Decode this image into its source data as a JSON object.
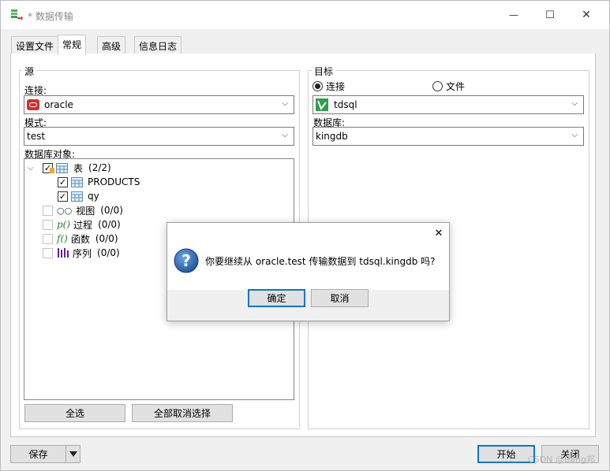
{
  "window": {
    "title": "* 数据传输",
    "icon": "data-transfer-icon",
    "controls": {
      "minimize": "—",
      "maximize": "☐",
      "close": "✕"
    }
  },
  "tabs": [
    {
      "label": "设置文件",
      "active": false
    },
    {
      "label": "常规",
      "active": true
    },
    {
      "label": "高级",
      "active": false
    },
    {
      "label": "信息日志",
      "active": false
    }
  ],
  "source": {
    "group_label": "源",
    "connection_label": "连接:",
    "connection_value": "oracle",
    "connection_icon": "oracle-icon",
    "mode_label": "模式:",
    "mode_value": "test",
    "objects_label": "数据库对象:",
    "tree": {
      "tables": {
        "label": "表",
        "count": "(2/2)",
        "expanded": true
      },
      "table_items": [
        {
          "label": "PRODUCTS",
          "checked": true
        },
        {
          "label": "qy",
          "checked": true
        }
      ],
      "views": {
        "label": "视图",
        "count": "(0/0)"
      },
      "procedures": {
        "label": "过程",
        "count": "(0/0)"
      },
      "functions": {
        "label": "函数",
        "count": "(0/0)"
      },
      "sequences": {
        "label": "序列",
        "count": "(0/0)"
      }
    },
    "select_all": "全选",
    "deselect_all": "全部取消选择"
  },
  "target": {
    "group_label": "目标",
    "radio_connection": "连接",
    "radio_file": "文件",
    "selected": "connection",
    "connection_value": "tdsql",
    "connection_icon": "tdsql-icon",
    "database_label": "数据库:",
    "database_value": "kingdb"
  },
  "footer": {
    "save": "保存",
    "start": "开始",
    "close": "关闭",
    "watermark": "CSDN @Bang邦"
  },
  "dialog": {
    "message": "你要继续从 oracle.test 传输数据到 tdsql.kingdb 吗?",
    "ok": "确定",
    "cancel": "取消",
    "icon": "question-icon",
    "accent": "#0078d7"
  }
}
